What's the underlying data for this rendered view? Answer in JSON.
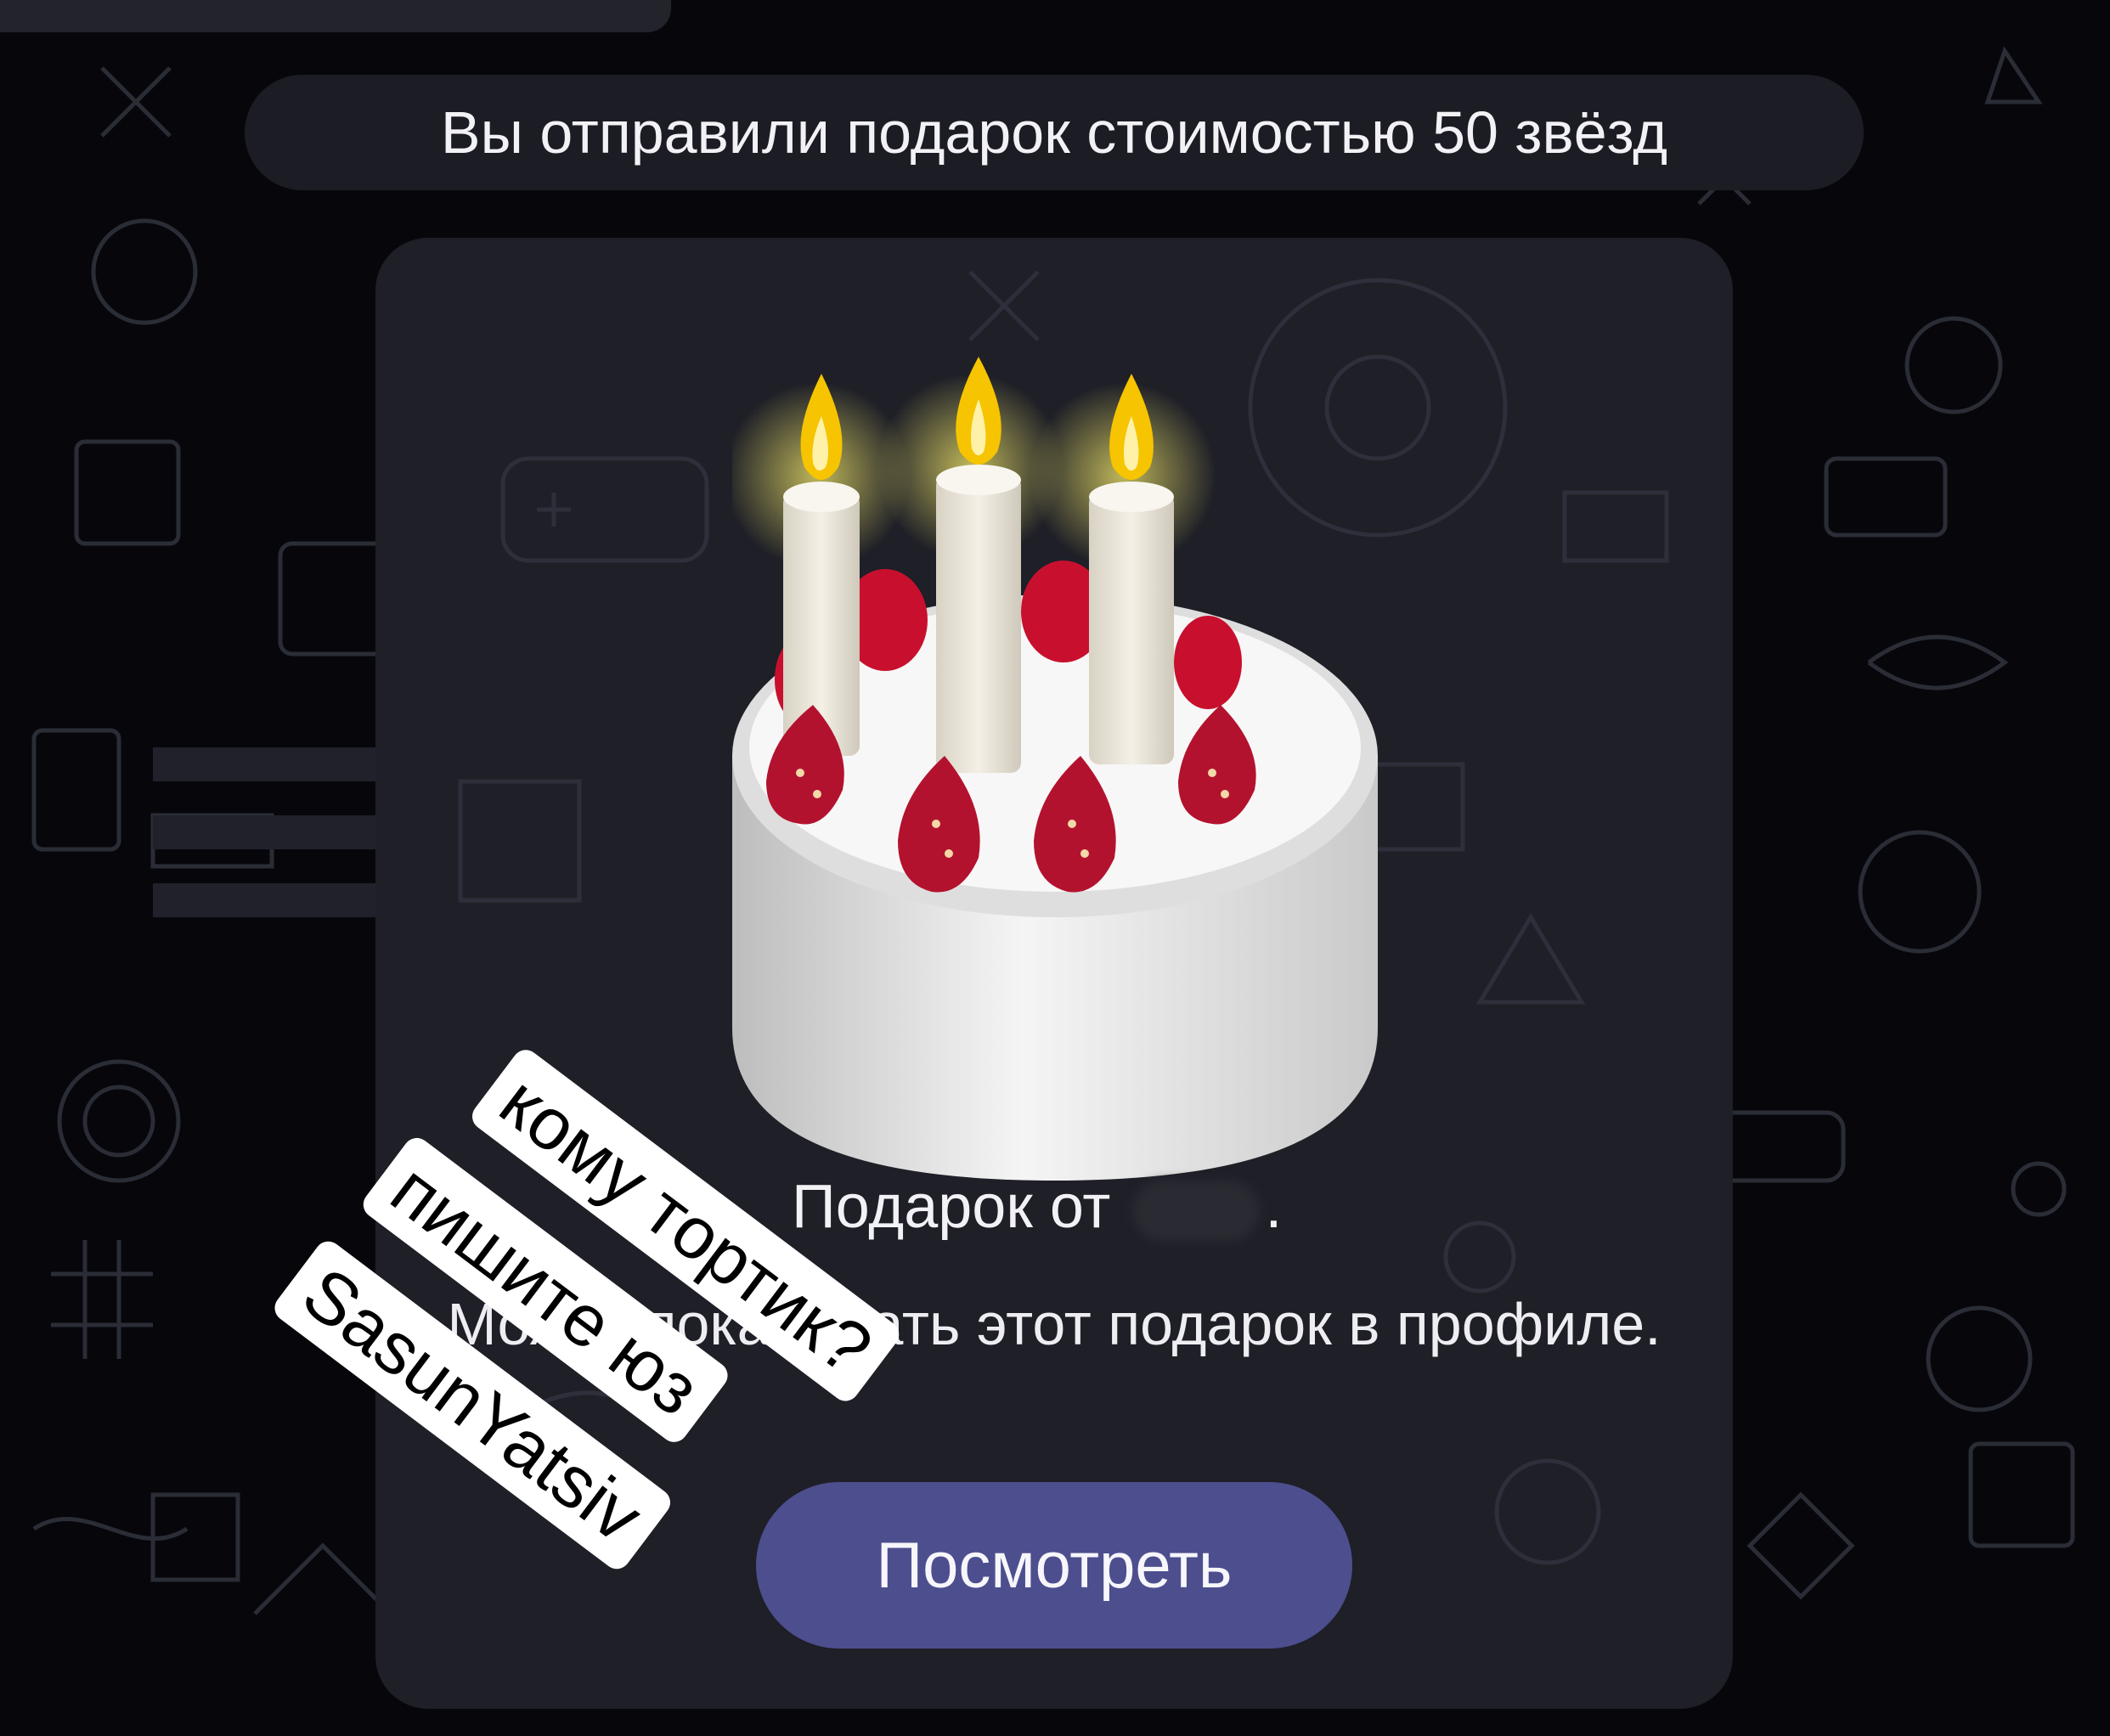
{
  "service_message": {
    "text": "Вы отправили подарок стоимостью 50 звёзд"
  },
  "gift": {
    "title_prefix": "Подарок от",
    "title_suffix": ".",
    "description": "Может показывать этот подарок в профиле.",
    "view_button": "Посмотреть",
    "emoji": "cake-with-candles"
  },
  "sticker": {
    "line1": "кому тортик?",
    "line2": "пишите юз",
    "line3": "SasunYatsiv"
  },
  "colors": {
    "background": "#07070b",
    "card": "#1e1f27",
    "button": "#4d4e8e",
    "sticker_bg": "#ffffff"
  }
}
